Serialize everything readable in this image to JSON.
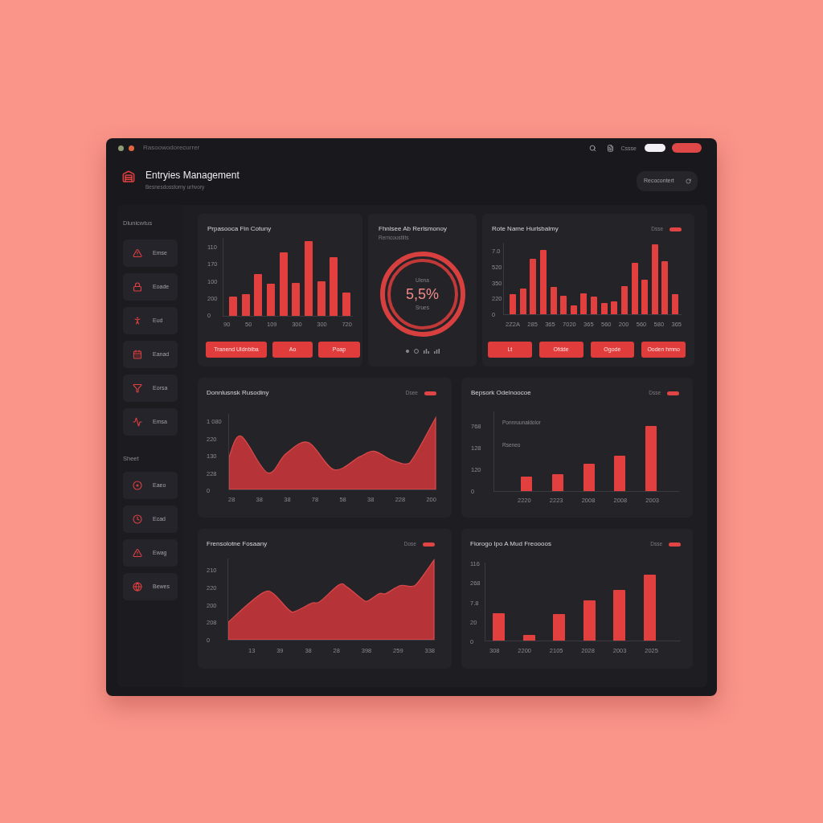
{
  "window": {
    "title": "Rasoowodorecurrer",
    "toolbar_text": "Cssse"
  },
  "header": {
    "title": "Entryies Management",
    "subtitle": "Besnesdosstorny urhvory",
    "button": "Recocontert"
  },
  "sidebar": {
    "sections": [
      {
        "label": "Dlunicwtus",
        "items": [
          {
            "label": "Emse"
          },
          {
            "label": "Eoade"
          },
          {
            "label": "Eud"
          },
          {
            "label": "Eanad"
          },
          {
            "label": "Eorsa"
          },
          {
            "label": "Emsa"
          }
        ]
      },
      {
        "label": "Sheet",
        "items": [
          {
            "label": "Eaeo"
          },
          {
            "label": "Ecad"
          },
          {
            "label": "Ewag"
          },
          {
            "label": "Bewes"
          }
        ]
      }
    ]
  },
  "cards": [
    {
      "kind": "bar",
      "title": "Prpasooca Fin Cotuny",
      "y_ticks": [
        "110",
        "170",
        "100",
        "200",
        "0"
      ],
      "x_labels": [
        "90",
        "50",
        "109",
        "300",
        "300",
        "720"
      ],
      "buttons": [
        "Tranend Uldnbiba",
        "Ao",
        "Poap"
      ]
    },
    {
      "kind": "ring",
      "title": "Fhnlsee Ab Rerlsmonoy",
      "subtitle": "Rerncoustlits",
      "label": "Ulena",
      "value": "5,5%",
      "caption": "Srues"
    },
    {
      "kind": "bar",
      "title": "Rote Name Hurlsbalmy",
      "legend": "Dsse",
      "y_ticks": [
        "7.0",
        "520",
        "350",
        "220",
        "0"
      ],
      "x_labels": [
        "2Z2A",
        "285",
        "365",
        "7020",
        "365",
        "560",
        "200",
        "560",
        "580",
        "365"
      ],
      "buttons": [
        "Lt",
        "Ofdde",
        "Ogode",
        "Ooden hmno"
      ]
    },
    {
      "kind": "area",
      "title": "Donnlusnsk Rusodiny",
      "legend": "Dsee",
      "y_ticks": [
        "1 080",
        "220",
        "130",
        "228",
        "0"
      ],
      "x_labels": [
        "28",
        "38",
        "38",
        "78",
        "58",
        "38",
        "228",
        "200"
      ]
    },
    {
      "kind": "bar",
      "title": "Bepsork Odelnoocoe",
      "legend": "Dsse",
      "notes": [
        "Ponnruunaldolor",
        "Rseneo"
      ],
      "y_ticks": [
        "768",
        "128",
        "120",
        "0"
      ],
      "x_labels": [
        "2220",
        "2223",
        "2008",
        "2008",
        "2003"
      ]
    },
    {
      "kind": "area",
      "title": "Frensolotne Fosaany",
      "legend": "Dose",
      "y_ticks": [
        "210",
        "220",
        "200",
        "208",
        "0"
      ],
      "x_labels": [
        "13",
        "39",
        "38",
        "28",
        "398",
        "259",
        "338"
      ]
    },
    {
      "kind": "bar",
      "title": "Fiorogo Ipo A Mud Freoooos",
      "legend": "Dsse",
      "y_ticks": [
        "116",
        "268",
        "7.8",
        "20",
        "0"
      ],
      "x_labels": [
        "308",
        "2200",
        "2105",
        "2028",
        "2003",
        "2025"
      ]
    }
  ]
}
